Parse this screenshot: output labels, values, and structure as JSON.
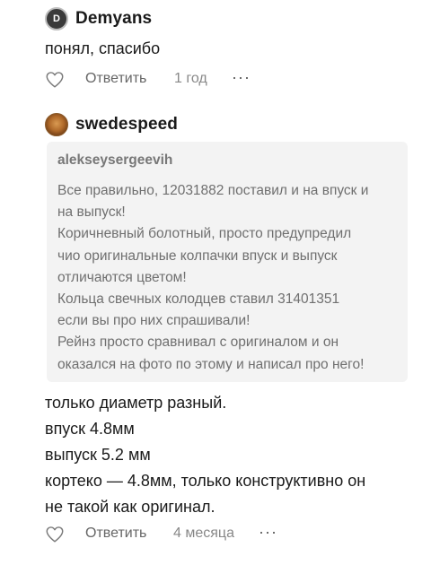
{
  "comments": [
    {
      "author": "Demyans",
      "avatar_letter": "D",
      "text_lines": [
        "понял, спасибо"
      ],
      "reply_label": "Ответить",
      "time": "1 год",
      "more_label": "···"
    },
    {
      "author": "swedespeed",
      "quote": {
        "author": "alekseysergeevih",
        "lines": [
          "Все правильно, 12031882 поставил и на впуск и",
          "на выпуск!",
          "Коричневный болотный, просто предупредил",
          "чио оригинальные колпачки впуск и выпуск",
          "отличаются цветом!",
          "Кольца свечных колодцев ставил 31401351",
          "если вы про них спрашивали!",
          "Рейнз просто сравнивал с оригиналом и он",
          "оказался на фото по этому и написал про него!"
        ]
      },
      "text_lines": [
        "только диаметр разный.",
        "впуск 4.8мм",
        "выпуск 5.2 мм",
        "кортеко — 4.8мм, только конструктивно он",
        "не такой как оригинал."
      ],
      "reply_label": "Ответить",
      "time": "4 месяца",
      "more_label": "···"
    }
  ],
  "colors": {
    "text": "#1a1a1a",
    "muted": "#666666",
    "quote_bg": "#f3f3f3"
  }
}
